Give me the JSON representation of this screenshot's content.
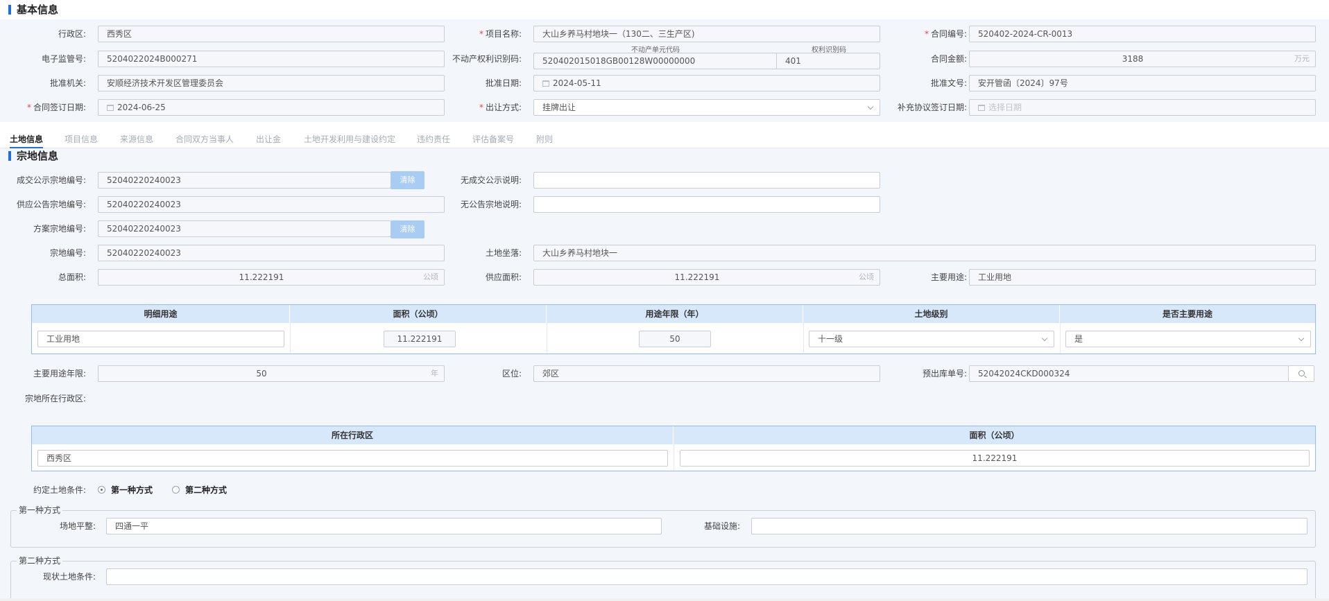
{
  "basic": {
    "title": "基本信息",
    "district_label": "行政区:",
    "district_value": "西秀区",
    "project_name_label": "项目名称:",
    "project_name_value": "大山乡养马村地块一（130二、三生产区)",
    "contract_no_label": "合同编号:",
    "contract_no_value": "520402-2024-CR-0013",
    "supervision_no_label": "电子监管号:",
    "supervision_no_value": "5204022024B000271",
    "property_code_label": "不动产权利识别码:",
    "unit_code_caption": "不动产单元代码",
    "unit_code_value": "520402015018GB00128W00000000",
    "right_code_caption": "权利识别码",
    "right_code_value": "401",
    "amount_label": "合同金额:",
    "amount_value": "3188",
    "amount_unit": "万元",
    "approval_org_label": "批准机关:",
    "approval_org_value": "安顺经济技术开发区管理委员会",
    "approval_date_label": "批准日期:",
    "approval_date_value": "2024-05-11",
    "approval_doc_label": "批准文号:",
    "approval_doc_value": "安开管函〔2024〕97号",
    "sign_date_label": "合同签订日期:",
    "sign_date_value": "2024-06-25",
    "transfer_method_label": "出让方式:",
    "transfer_method_value": "挂牌出让",
    "supplement_date_label": "补充协议签订日期:",
    "supplement_date_placeholder": "选择日期"
  },
  "tabs": [
    "土地信息",
    "项目信息",
    "来源信息",
    "合同双方当事人",
    "出让金",
    "土地开发利用与建设约定",
    "违约责任",
    "评估备案号",
    "附则"
  ],
  "parcel": {
    "title": "宗地信息",
    "deal_notice_no_label": "成交公示宗地编号:",
    "deal_notice_no_value": "52040220240023",
    "clear_label": "清除",
    "no_deal_notice_label": "无成交公示说明:",
    "no_deal_notice_value": "",
    "supply_notice_no_label": "供应公告宗地编号:",
    "supply_notice_no_value": "52040220240023",
    "no_notice_label": "无公告宗地说明:",
    "no_notice_value": "",
    "plan_no_label": "方案宗地编号:",
    "plan_no_value": "52040220240023",
    "parcel_no_label": "宗地编号:",
    "parcel_no_value": "52040220240023",
    "location_label": "土地坐落:",
    "location_value": "大山乡养马村地块一",
    "total_area_label": "总面积:",
    "total_area_value": "11.222191",
    "area_unit": "公顷",
    "supply_area_label": "供应面积:",
    "supply_area_value": "11.222191",
    "main_use_label": "主要用途:",
    "main_use_value": "工业用地",
    "use_table": {
      "headers": [
        "明细用途",
        "面积（公顷）",
        "用途年限（年）",
        "土地级别",
        "是否主要用途"
      ],
      "row": {
        "use": "工业用地",
        "area": "11.222191",
        "years": "50",
        "grade": "十一级",
        "is_main": "是"
      }
    },
    "main_use_years_label": "主要用途年限:",
    "main_use_years_value": "50",
    "years_unit": "年",
    "zone_label": "区位:",
    "zone_value": "郊区",
    "pre_out_no_label": "预出库单号:",
    "pre_out_no_value": "52042024CKD000324",
    "parcel_district_label": "宗地所在行政区:",
    "district_table": {
      "headers": [
        "所在行政区",
        "面积（公顷）"
      ],
      "row": {
        "district": "西秀区",
        "area": "11.222191"
      }
    },
    "condition_label": "约定土地条件:",
    "option1": "第一种方式",
    "option2": "第二种方式",
    "fs1_legend": "第一种方式",
    "site_level_label": "场地平整:",
    "site_level_value": "四通一平",
    "infrastructure_label": "基础设施:",
    "infrastructure_value": "",
    "fs2_legend": "第二种方式",
    "current_cond_label": "现状土地条件:",
    "current_cond_value": ""
  }
}
